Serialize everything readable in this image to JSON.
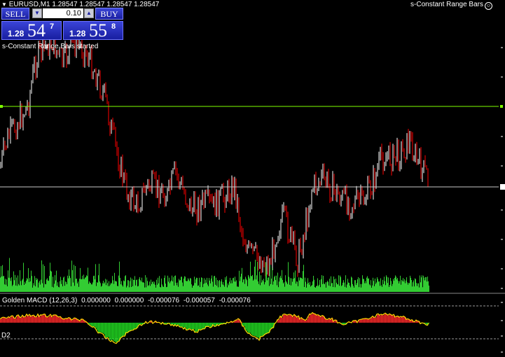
{
  "header": {
    "symbol_tf": "EURUSD,M1",
    "prices": "1.28547 1.28547 1.28547 1.28547",
    "indicator_name": "s-Constant Range Bars",
    "smile_icon": "smiley-icon"
  },
  "trade_panel": {
    "sell_label": "SELL",
    "buy_label": "BUY",
    "lot": "0.10",
    "bid_small": "1.28",
    "bid_big": "54",
    "bid_sup": "7",
    "ask_small": "1.28",
    "ask_big": "55",
    "ask_sup": "8"
  },
  "status_text": "s-Constant Range Bars started",
  "macd": {
    "label": "Golden MACD (12,26,3)",
    "values": [
      "0.000000",
      "0.000000",
      "-0.000076",
      "-0.000057",
      "-0.000076"
    ],
    "level_label": "D2"
  },
  "colors": {
    "background": "#000000",
    "up_candle": "#ffffff",
    "down_candle": "#ff0000",
    "volume": "#33cc33",
    "horizontal_line": "#7fff00",
    "macd_pos": "#ff2a2a",
    "macd_neg": "#22dd22",
    "macd_signal": "#ffd700"
  }
}
